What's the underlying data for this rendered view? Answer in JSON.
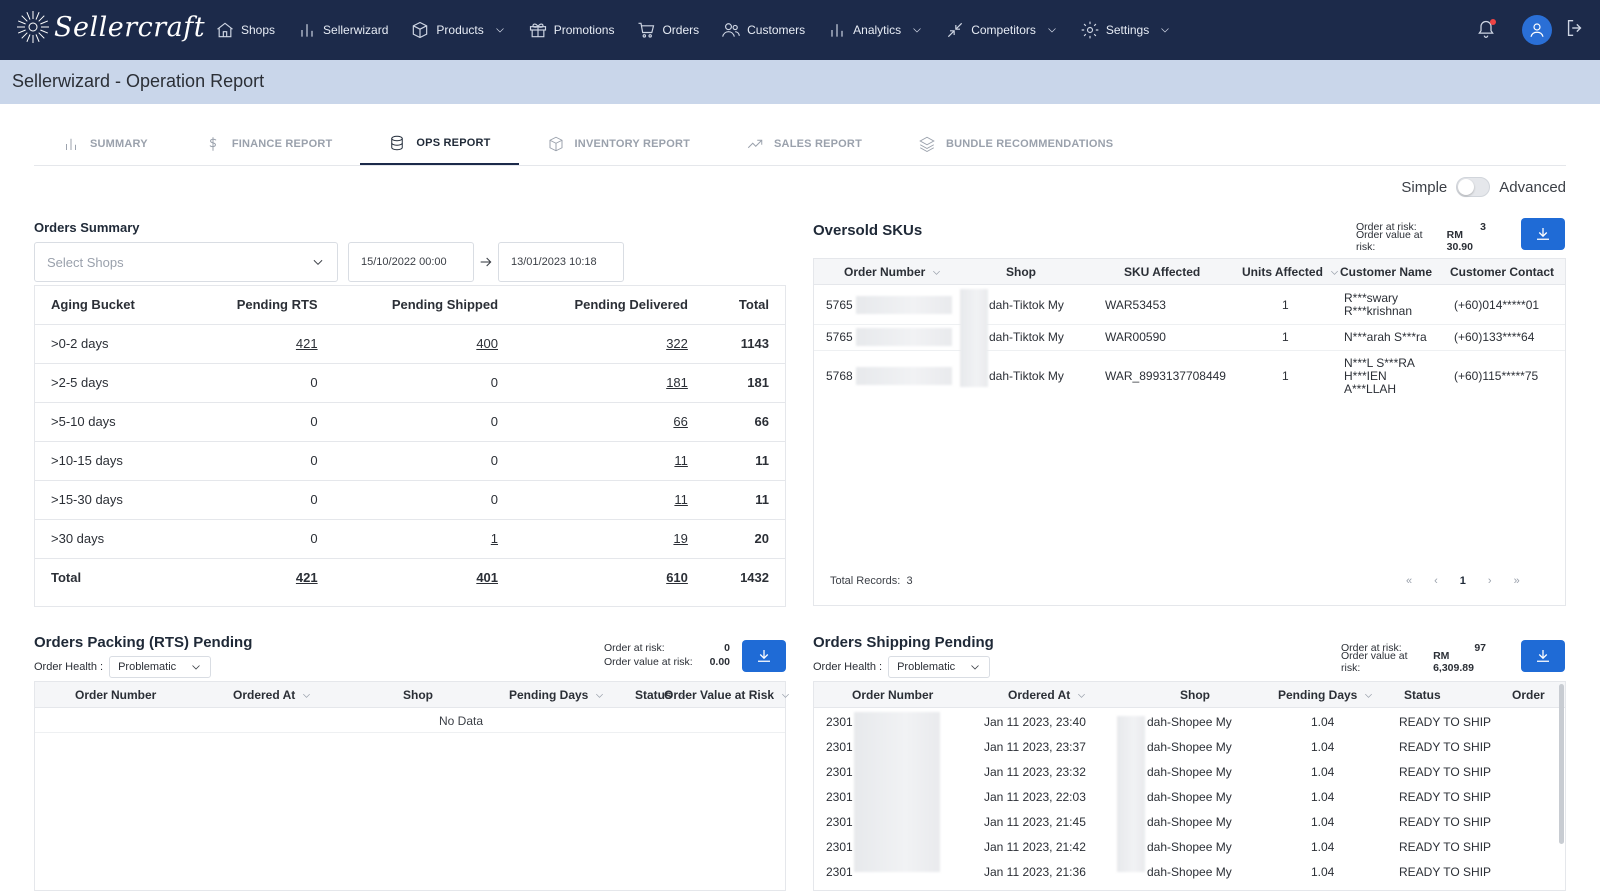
{
  "brand": {
    "name": "Sellercraft"
  },
  "nav": {
    "items": [
      {
        "label": "Shops",
        "icon": "home-icon",
        "chevron": false
      },
      {
        "label": "Sellerwizard",
        "icon": "bar-chart-icon",
        "chevron": false
      },
      {
        "label": "Products",
        "icon": "box-icon",
        "chevron": true
      },
      {
        "label": "Promotions",
        "icon": "gift-icon",
        "chevron": false
      },
      {
        "label": "Orders",
        "icon": "cart-icon",
        "chevron": false
      },
      {
        "label": "Customers",
        "icon": "users-icon",
        "chevron": false
      },
      {
        "label": "Analytics",
        "icon": "bar-chart-icon",
        "chevron": true
      },
      {
        "label": "Competitors",
        "icon": "compress-icon",
        "chevron": true
      },
      {
        "label": "Settings",
        "icon": "gear-icon",
        "chevron": true
      }
    ]
  },
  "page_title": "Sellerwizard - Operation Report",
  "tabs": [
    {
      "label": "SUMMARY",
      "icon": "bar-chart-icon",
      "active": false
    },
    {
      "label": "FINANCE REPORT",
      "icon": "dollar-icon",
      "active": false
    },
    {
      "label": "OPS REPORT",
      "icon": "database-icon",
      "active": true
    },
    {
      "label": "INVENTORY REPORT",
      "icon": "cube-icon",
      "active": false
    },
    {
      "label": "SALES REPORT",
      "icon": "trend-icon",
      "active": false
    },
    {
      "label": "BUNDLE RECOMMENDATIONS",
      "icon": "layers-icon",
      "active": false
    }
  ],
  "mode_toggle": {
    "left_label": "Simple",
    "right_label": "Advanced",
    "enabled": false
  },
  "orders_summary": {
    "title": "Orders Summary",
    "shop_select_placeholder": "Select Shops",
    "date_from": "15/10/2022 00:00",
    "date_to": "13/01/2023 10:18",
    "columns": [
      "Aging Bucket",
      "Pending RTS",
      "Pending Shipped",
      "Pending Delivered",
      "Total"
    ],
    "rows": [
      {
        "bucket": ">0-2 days",
        "rts": "421",
        "shipped": "400",
        "delivered": "322",
        "total": "1143",
        "link_rts": true,
        "link_shipped": true,
        "link_delivered": true
      },
      {
        "bucket": ">2-5 days",
        "rts": "0",
        "shipped": "0",
        "delivered": "181",
        "total": "181",
        "link_rts": false,
        "link_shipped": false,
        "link_delivered": true
      },
      {
        "bucket": ">5-10 days",
        "rts": "0",
        "shipped": "0",
        "delivered": "66",
        "total": "66",
        "link_rts": false,
        "link_shipped": false,
        "link_delivered": true
      },
      {
        "bucket": ">10-15 days",
        "rts": "0",
        "shipped": "0",
        "delivered": "11",
        "total": "11",
        "link_rts": false,
        "link_shipped": false,
        "link_delivered": true
      },
      {
        "bucket": ">15-30 days",
        "rts": "0",
        "shipped": "0",
        "delivered": "11",
        "total": "11",
        "link_rts": false,
        "link_shipped": false,
        "link_delivered": true
      },
      {
        "bucket": ">30 days",
        "rts": "0",
        "shipped": "1",
        "delivered": "19",
        "total": "20",
        "link_rts": false,
        "link_shipped": true,
        "link_delivered": true
      }
    ],
    "total_row": {
      "label": "Total",
      "rts": "421",
      "shipped": "401",
      "delivered": "610",
      "total": "1432"
    }
  },
  "oversold": {
    "title": "Oversold SKUs",
    "risk_label": "Order at risk:",
    "risk_value": "3",
    "value_label": "Order value at risk:",
    "value_value": "RM 30.90",
    "columns": [
      "Order Number",
      "Shop",
      "SKU Affected",
      "Units Affected",
      "Customer Name",
      "Customer Contact"
    ],
    "rows": [
      {
        "order": "5765",
        "shop": "dah-Tiktok My",
        "sku": "WAR53453",
        "units": "1",
        "name": [
          "R***swary",
          "R***krishnan"
        ],
        "contact": "(+60)014*****01"
      },
      {
        "order": "5765",
        "shop": "dah-Tiktok My",
        "sku": "WAR00590",
        "units": "1",
        "name": [
          "N***arah S***ra"
        ],
        "contact": "(+60)133****64"
      },
      {
        "order": "5768",
        "shop": "dah-Tiktok My",
        "sku": "WAR_8993137708449",
        "units": "1",
        "name": [
          "N***L S***RA",
          "H***IEN",
          "A***LLAH"
        ],
        "contact": "(+60)115*****75"
      }
    ],
    "total_records_label": "Total Records:",
    "total_records": "3",
    "current_page": "1"
  },
  "rts_pending": {
    "title": "Orders Packing (RTS) Pending",
    "health_label": "Order Health :",
    "health_value": "Problematic",
    "risk_label": "Order at risk:",
    "risk_value": "0",
    "value_label": "Order value at risk:",
    "value_value": "0.00",
    "columns": [
      "Order Number",
      "Ordered At",
      "Shop",
      "Pending Days",
      "Status",
      "Order Value at Risk"
    ],
    "empty_text": "No Data"
  },
  "shipping_pending": {
    "title": "Orders Shipping Pending",
    "health_label": "Order Health :",
    "health_value": "Problematic",
    "risk_label": "Order at risk:",
    "risk_value": "97",
    "value_label": "Order value at risk:",
    "value_value": "RM 6,309.89",
    "columns": [
      "Order Number",
      "Ordered At",
      "Shop",
      "Pending Days",
      "Status",
      "Order"
    ],
    "rows": [
      {
        "order": "2301",
        "ordered_at": "Jan 11 2023, 23:40",
        "shop": "dah-Shopee My",
        "days": "1.04",
        "status": "READY TO SHIP"
      },
      {
        "order": "2301",
        "ordered_at": "Jan 11 2023, 23:37",
        "shop": "dah-Shopee My",
        "days": "1.04",
        "status": "READY TO SHIP"
      },
      {
        "order": "2301",
        "ordered_at": "Jan 11 2023, 23:32",
        "shop": "dah-Shopee My",
        "days": "1.04",
        "status": "READY TO SHIP"
      },
      {
        "order": "2301",
        "ordered_at": "Jan 11 2023, 22:03",
        "shop": "dah-Shopee My",
        "days": "1.04",
        "status": "READY TO SHIP"
      },
      {
        "order": "2301",
        "ordered_at": "Jan 11 2023, 21:45",
        "shop": "dah-Shopee My",
        "days": "1.04",
        "status": "READY TO SHIP"
      },
      {
        "order": "2301",
        "ordered_at": "Jan 11 2023, 21:42",
        "shop": "dah-Shopee My",
        "days": "1.04",
        "status": "READY TO SHIP"
      },
      {
        "order": "2301",
        "ordered_at": "Jan 11 2023, 21:36",
        "shop": "dah-Shopee My",
        "days": "1.04",
        "status": "READY TO SHIP"
      }
    ]
  }
}
